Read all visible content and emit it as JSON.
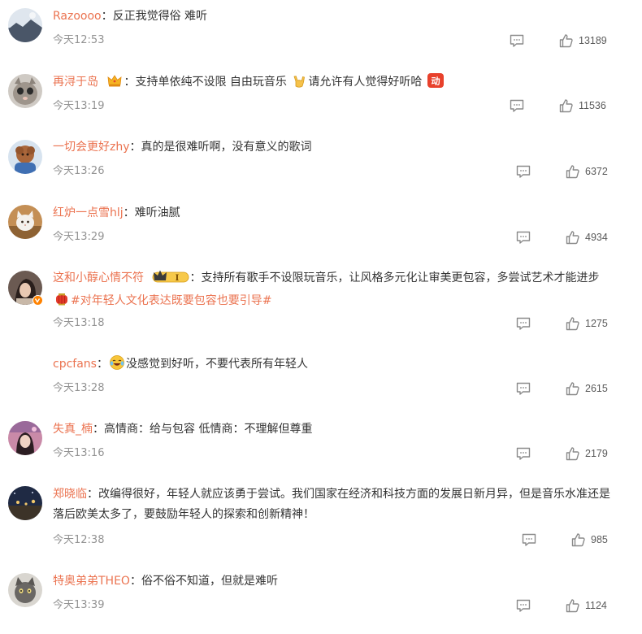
{
  "comments": [
    {
      "user": "Razoooo",
      "colon": "：",
      "text": "反正我觉得俗 难听",
      "time": "今天12:53",
      "likes": "13189",
      "avatar_color": "#7a8ea6"
    },
    {
      "user": "再浔于岛",
      "colon": "：",
      "text_1": "支持单依纯不设限 自由玩音乐",
      "text_2": "请允许有人觉得好听哈",
      "time": "今天13:19",
      "likes": "11536",
      "avatar_color": "#8b8b8b",
      "badge_text": "动"
    },
    {
      "user": "一切会更好zhy",
      "colon": "：",
      "text": "真的是很难听啊，没有意义的歌词",
      "time": "今天13:26",
      "likes": "6372",
      "avatar_color": "#b0713f"
    },
    {
      "user": "红炉一点雪hlj",
      "colon": "：",
      "text": "难听油腻",
      "time": "今天13:29",
      "likes": "4934",
      "avatar_color": "#c89a64"
    },
    {
      "user": "这和小醇心情不符",
      "colon": "：",
      "text_1": "支持所有歌手不设限玩音乐，让风格多元化让审美更包容，多尝试艺术才能",
      "text_2": "进步",
      "hashtag": "#对年轻人文化表达既要包容也要引导#",
      "time": "今天13:18",
      "likes": "1275",
      "avatar_color": "#5b4a45",
      "level": "I"
    },
    {
      "user": "cpcfans",
      "colon": "：",
      "text": "没感觉到好听，不要代表所有年轻人",
      "time": "今天13:28",
      "likes": "2615"
    },
    {
      "user": "失真_楠",
      "colon": "：",
      "text": "高情商：给与包容 低情商：不理解但尊重",
      "time": "今天13:16",
      "likes": "2179",
      "avatar_color": "#b86f8a"
    },
    {
      "user": "郑晓临",
      "colon": "：",
      "text_1": "改编得很好，年轻人就应该勇于尝试。我们国家在经济和科技方面的发展日新月异，但是音乐水",
      "text_2": "准还是落后欧美太多了，要鼓励年轻人的探索和创新精神！",
      "time": "今天12:38",
      "likes": "985",
      "avatar_color": "#2e3d5c"
    },
    {
      "user": "特奥弟弟THEO",
      "colon": "：",
      "text": "俗不俗不知道，但就是难听",
      "time": "今天13:39",
      "likes": "1124",
      "avatar_color": "#6c6c6c"
    }
  ],
  "icons": {
    "reply": "comment-icon",
    "like": "thumbs-up-icon"
  },
  "colors": {
    "username": "#eb7350",
    "timestamp": "#939393",
    "body": "#333333"
  }
}
